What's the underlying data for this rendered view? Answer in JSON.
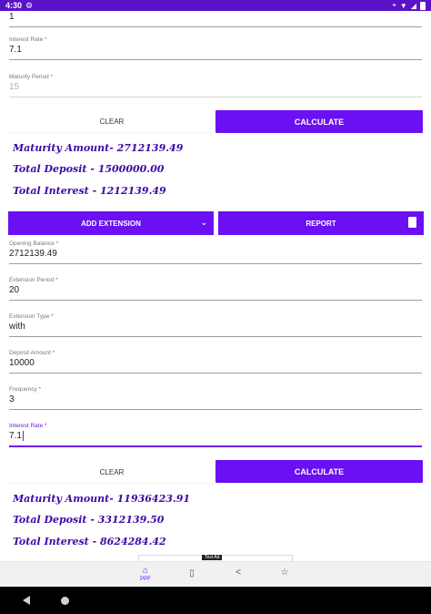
{
  "status": {
    "time": "4:30"
  },
  "top_fields": [
    {
      "label": "",
      "value": "1"
    },
    {
      "label": "Interest Rate *",
      "value": "7.1"
    },
    {
      "label": "Maturity Period *",
      "value": "15"
    }
  ],
  "buttons": {
    "clear": "CLEAR",
    "calculate": "CALCULATE",
    "add_extension": "ADD EXTENSION",
    "report": "REPORT"
  },
  "results_top": {
    "maturity": "Maturity Amount-  2712139.49",
    "deposit": "Total Deposit -  1500000.00",
    "interest": "Total Interest -  1212139.49"
  },
  "ext_fields": [
    {
      "label": "Opening Balance *",
      "value": "2712139.49"
    },
    {
      "label": "Extension Period *",
      "value": "20"
    },
    {
      "label": "Extension Type *",
      "value": "with"
    },
    {
      "label": "Deposit Amount *",
      "value": "10000"
    },
    {
      "label": "Frequency *",
      "value": "3"
    },
    {
      "label": "Interest Rate *",
      "value": "7.1"
    }
  ],
  "results_bottom": {
    "maturity": "Maturity Amount-  11936423.91",
    "deposit": "Total Deposit -  3312139.50",
    "interest": "Total Interest -  8624284.42"
  },
  "ad": {
    "tag": "Test Ad"
  },
  "nav": {
    "ppf_label": "PPF"
  },
  "colors": {
    "accent": "#6a10f2",
    "status_bar": "#5a12c9",
    "result_text": "#3b0aa6"
  }
}
